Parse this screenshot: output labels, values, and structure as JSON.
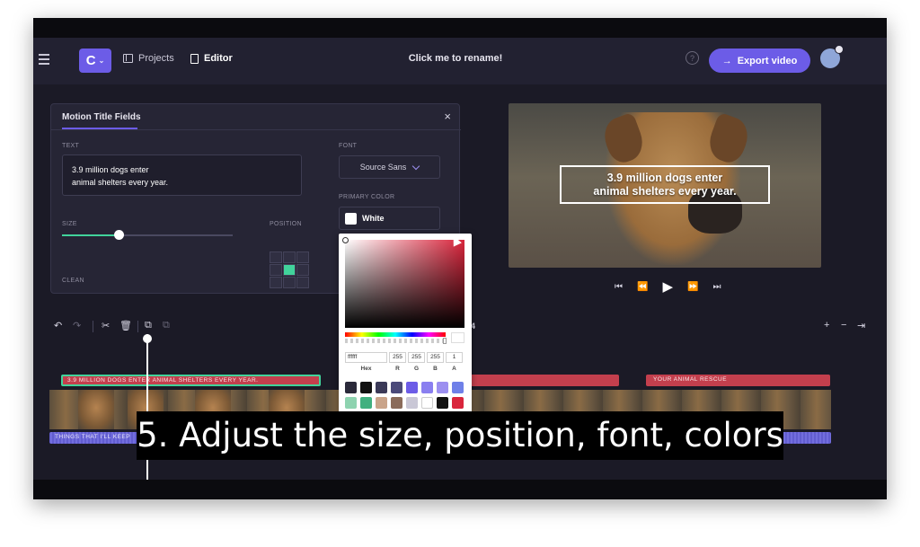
{
  "header": {
    "logo_letter": "C",
    "nav": {
      "projects_label": "Projects",
      "editor_label": "Editor"
    },
    "project_name": "Click me to rename!",
    "help_glyph": "?",
    "export_label": "Export video"
  },
  "title_panel": {
    "title": "Motion Title Fields",
    "close_glyph": "×",
    "text_label": "TEXT",
    "text_value": "3.9 million dogs enter\nanimal shelters every year.",
    "size_label": "SIZE",
    "size_value_fraction": 0.33,
    "position_label": "POSITION",
    "clean_label": "CLEAN",
    "font_label": "FONT",
    "font_value": "Source Sans",
    "primary_color_label": "PRIMARY COLOR",
    "primary_color_value": "White"
  },
  "color_picker": {
    "hex_value": "ffffff",
    "r": "255",
    "g": "255",
    "b": "255",
    "a": "1",
    "labels": {
      "hex": "Hex",
      "r": "R",
      "g": "G",
      "b": "B",
      "a": "A"
    },
    "presets": [
      "#2b2a3a",
      "#111111",
      "#3b3a58",
      "#4b4a7a",
      "#6c5ce7",
      "#8a7ff0",
      "#9c8ff0",
      "#6f80e8",
      "#8ed3b0",
      "#41b07f",
      "#c9a48a",
      "#8a6b5a",
      "#c9c7d6",
      "#ffffff",
      "#111111",
      "#d9253c"
    ]
  },
  "preview": {
    "title_line1": "3.9 million dogs enter",
    "title_line2": "animal shelters every year."
  },
  "timeline": {
    "timecode_fragment": "4",
    "tracks": {
      "title_clip_label": "3.9 MILLION DOGS ENTER ANIMAL SHELTERS EVERY YEAR.",
      "right_clip_label": "YOUR ANIMAL RESCUE",
      "audio_label": "THINGS THAT I'LL KEEP"
    }
  },
  "caption": "5. Adjust the size, position, font, colors",
  "colors": {
    "accent": "#6c5ce7",
    "green": "#41d39b",
    "title_clip": "#c33f4d",
    "audio_clip": "#5a55c8"
  }
}
